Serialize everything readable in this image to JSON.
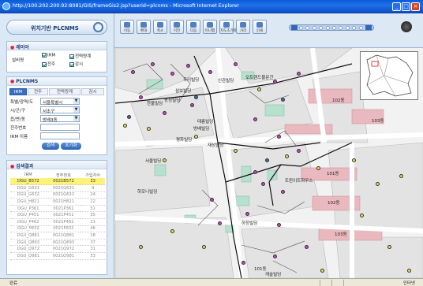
{
  "window": {
    "title": "http://100.202.200.92:8081/GIS/frameGis2.jsp?userid=plcnms - Microsoft Internet Explorer",
    "min": "_",
    "max": "□",
    "close": "×"
  },
  "sidebar": {
    "title": "위치기반 PLCNMS",
    "layer": {
      "heading": "레이어",
      "label": "설비명",
      "items": [
        "IRM",
        "전력량계",
        "전주",
        "감시"
      ]
    },
    "plcnms": {
      "heading": "PLCNMS",
      "tabs": [
        "IRM",
        "전주",
        "전력량계",
        "감시"
      ],
      "fields": [
        {
          "label": "특별/광역/도",
          "value": "서울특별시"
        },
        {
          "label": "시/군/구",
          "value": "서초구"
        },
        {
          "label": "읍/면/동",
          "value": "방배3동"
        },
        {
          "label": "전주번호",
          "value": ""
        },
        {
          "label": "IRM 이름",
          "value": ""
        }
      ],
      "search_btn": "검색",
      "reset_btn": "초기화"
    },
    "results": {
      "heading": "검색결과",
      "columns": [
        "IRM",
        "전주번호",
        "가입자수"
      ],
      "rows": [
        [
          "DGU_B572",
          "0021B572",
          "33"
        ],
        [
          "DGU_G631",
          "0021G631",
          "9"
        ],
        [
          "DGU_G632",
          "0021G632",
          "24"
        ],
        [
          "DGU_H821",
          "0021H821",
          "22"
        ],
        [
          "DGU_P361",
          "0021P361",
          "51"
        ],
        [
          "DGU_P451",
          "0021P451",
          "35"
        ],
        [
          "DGU_P462",
          "0021P462",
          "21"
        ],
        [
          "DGU_P832",
          "0021P832",
          "46"
        ],
        [
          "DGU_Q881",
          "0021Q881",
          "28"
        ],
        [
          "DGU_Q893",
          "0021Q893",
          "37"
        ],
        [
          "DGU_Q972",
          "0021Q972",
          "31"
        ],
        [
          "DGU_Q981",
          "0021Q981",
          "53"
        ]
      ]
    }
  },
  "toolbar": {
    "buttons": [
      "이동",
      "확대",
      "축소",
      "이전",
      "다음",
      "미니맵",
      "지도초기화",
      "거리",
      "인쇄"
    ],
    "zoom_level": 0.88
  },
  "map": {
    "labels": [
      "우리빌딩",
      "신관빌딩",
      "오트렌드물문건",
      "삼보빌딩",
      "한불빌딩",
      "동성빌딩",
      "태릉빌딩",
      "방배빌딩",
      "평화빌딩",
      "재성빌딩",
      "서울빌딩",
      "하모니빌딩",
      "트윈이트하우스",
      "102동",
      "103동",
      "101동",
      "102동",
      "103동",
      "101동",
      "캐슬빌딩",
      "하정빌딩"
    ]
  },
  "status": {
    "left": "완료",
    "right": "인터넷"
  },
  "colors": {
    "highlight": "#fff27a",
    "accent": "#3a6fc0"
  }
}
